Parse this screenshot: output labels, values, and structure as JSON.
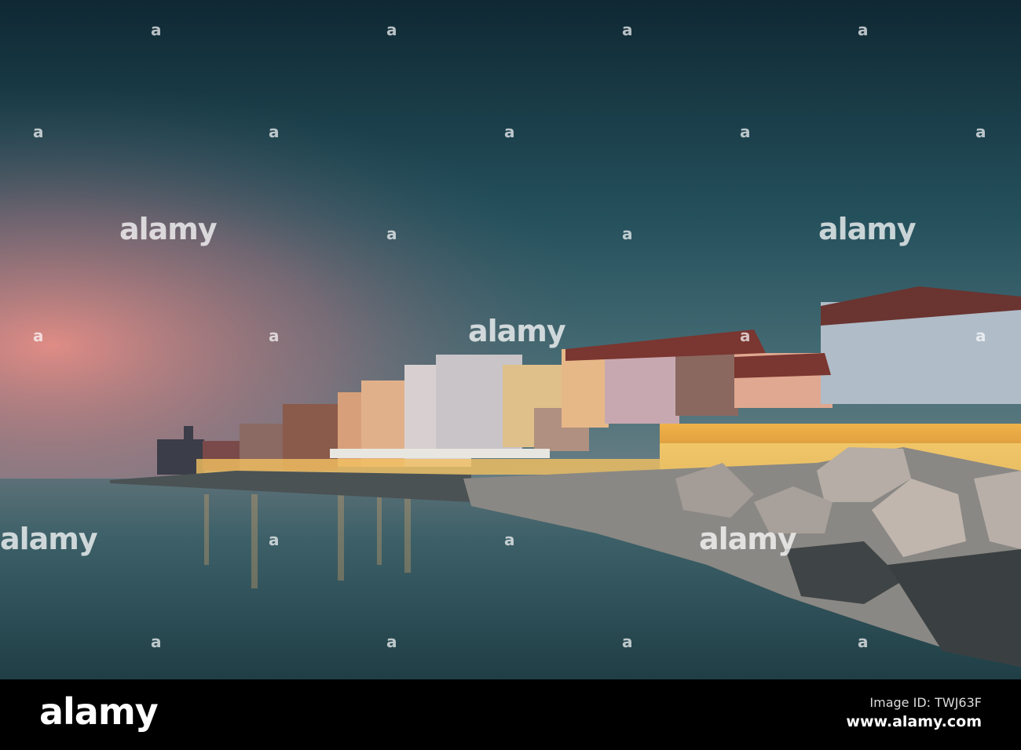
{
  "photo": {
    "subject": "Seaside town waterfront at dusk",
    "colors": {
      "sky_top": "#112a35",
      "sky_mid": "#2f5b66",
      "sky_glow": "#d98a86",
      "water": "#3b6068",
      "lights": "#f4c25a"
    }
  },
  "watermark": {
    "text": "alamy",
    "glyph": "a"
  },
  "footer": {
    "logo": "alamy",
    "image_id": "Image ID: TWJ63F",
    "url": "www.alamy.com"
  }
}
